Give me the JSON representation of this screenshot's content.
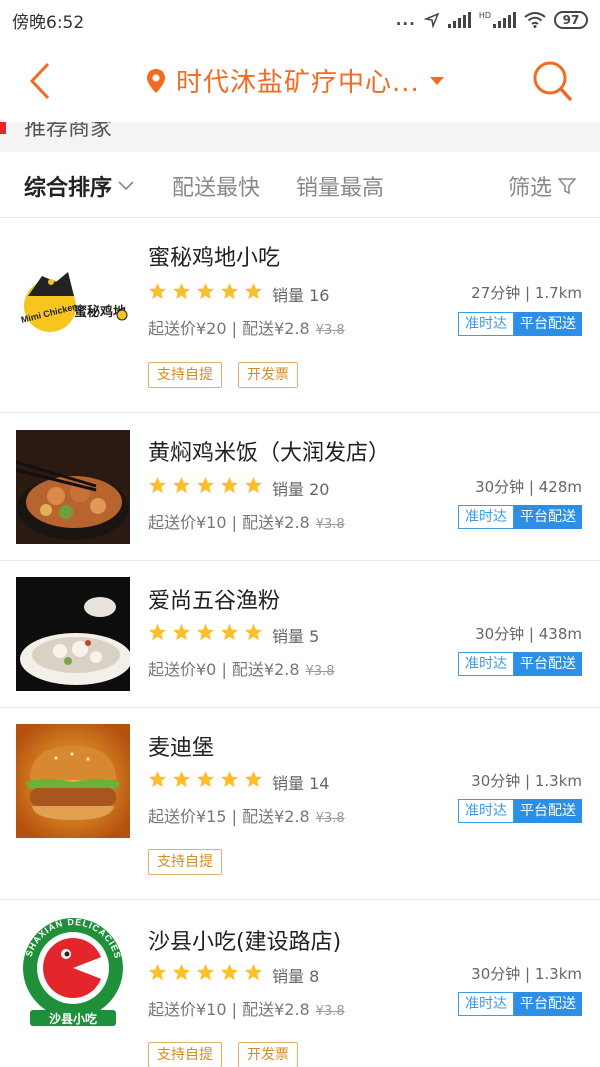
{
  "status_bar": {
    "time": "傍晚6:52",
    "dots": "...",
    "hd": "HD",
    "battery": "97"
  },
  "header": {
    "location_title": "时代沐盐矿疗中心...",
    "accent_color": "#f36b21"
  },
  "section_peek": {
    "title": "推荐商家"
  },
  "sort_bar": {
    "active": "综合排序",
    "fastest": "配送最快",
    "top_sales": "销量最高",
    "filter": "筛选"
  },
  "shops": [
    {
      "name": "蜜秘鸡地小吃",
      "rating": 5,
      "sales": "销量 16",
      "distance": "27分钟 | 1.7km",
      "fee": "起送价¥20 | 配送¥2.8",
      "fee_orig": "¥3.8",
      "badge_ontime": "准时达",
      "badge_platform": "平台配送",
      "tags": [
        "支持自提",
        "开发票"
      ],
      "logo_text_en": "Mimi Chicken",
      "logo_text_cn": "蜜秘鸡地"
    },
    {
      "name": "黄焖鸡米饭（大润发店）",
      "rating": 5,
      "sales": "销量 20",
      "distance": "30分钟 | 428m",
      "fee": "起送价¥10 | 配送¥2.8",
      "fee_orig": "¥3.8",
      "badge_ontime": "准时达",
      "badge_platform": "平台配送",
      "tags": []
    },
    {
      "name": "爱尚五谷渔粉",
      "rating": 5,
      "sales": "销量 5",
      "distance": "30分钟 | 438m",
      "fee": "起送价¥0 | 配送¥2.8",
      "fee_orig": "¥3.8",
      "badge_ontime": "准时达",
      "badge_platform": "平台配送",
      "tags": []
    },
    {
      "name": "麦迪堡",
      "rating": 5,
      "sales": "销量 14",
      "distance": "30分钟 | 1.3km",
      "fee": "起送价¥15 | 配送¥2.8",
      "fee_orig": "¥3.8",
      "badge_ontime": "准时达",
      "badge_platform": "平台配送",
      "tags": [
        "支持自提"
      ]
    },
    {
      "name": "沙县小吃(建设路店)",
      "rating": 5,
      "sales": "销量 8",
      "distance": "30分钟 | 1.3km",
      "fee": "起送价¥10 | 配送¥2.8",
      "fee_orig": "¥3.8",
      "badge_ontime": "准时达",
      "badge_platform": "平台配送",
      "tags": [
        "支持自提",
        "开发票"
      ],
      "logo_text_ring": "SHAXIAN DELICACIES",
      "logo_text_cn": "沙县小吃"
    }
  ]
}
